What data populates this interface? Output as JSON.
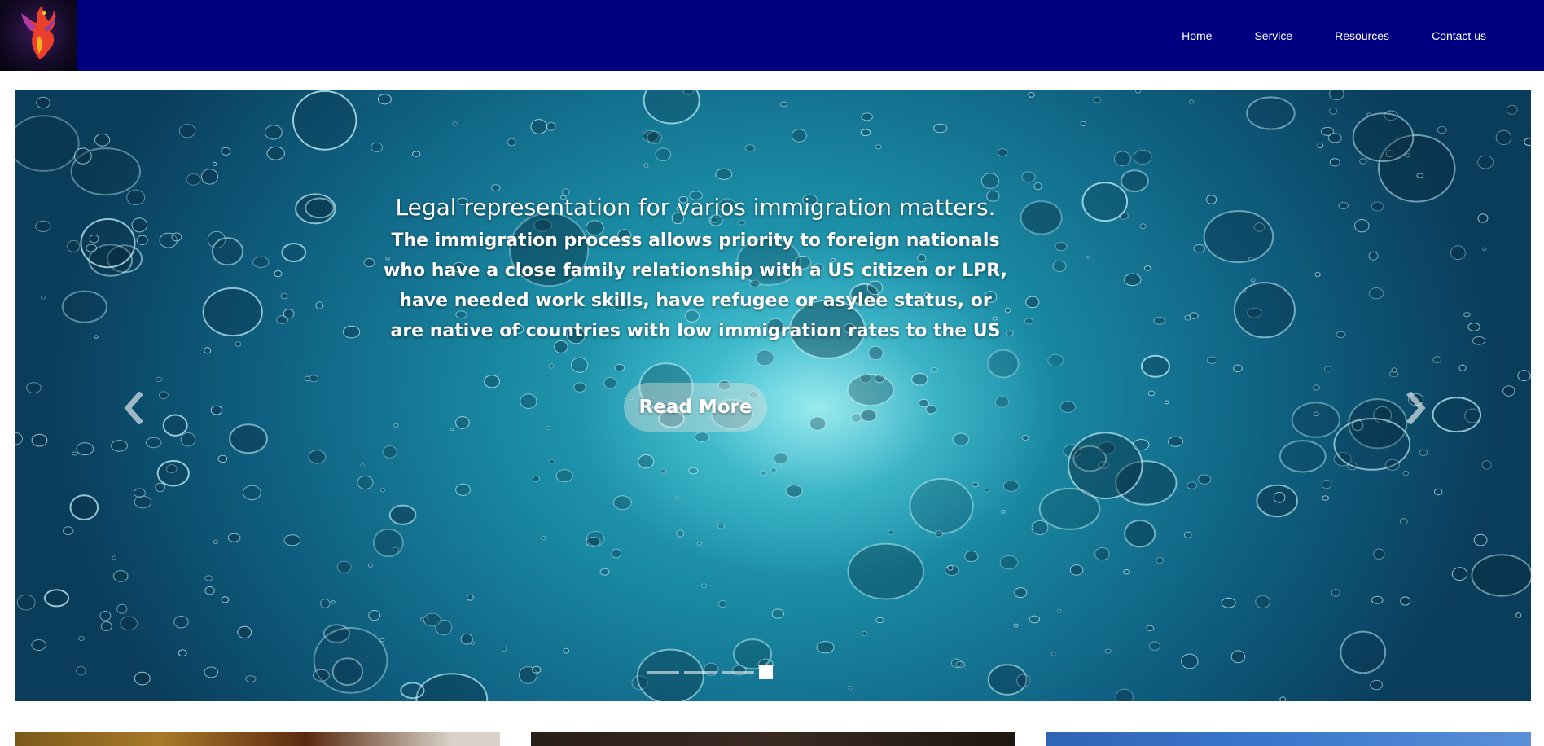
{
  "header": {
    "logo_icon": "phoenix-logo-icon",
    "background_color": "#000080",
    "nav": [
      {
        "label": "Home"
      },
      {
        "label": "Service"
      },
      {
        "label": "Resources"
      },
      {
        "label": "Contact us"
      }
    ]
  },
  "hero": {
    "title": "Legal representation for varios immigration matters.",
    "body": "The immigration process allows priority to foreign nationals who have a close family relationship with a US citizen or LPR, have needed work skills, have refugee or asylee status, or are native of countries with low immigration rates to the US",
    "cta_label": "Read More",
    "prev_icon": "chevron-left-icon",
    "next_icon": "chevron-right-icon",
    "slide_count": 4,
    "active_slide": 4
  },
  "cards": [
    {
      "image": "card-image-1"
    },
    {
      "image": "card-image-2"
    },
    {
      "image": "card-image-3"
    }
  ]
}
